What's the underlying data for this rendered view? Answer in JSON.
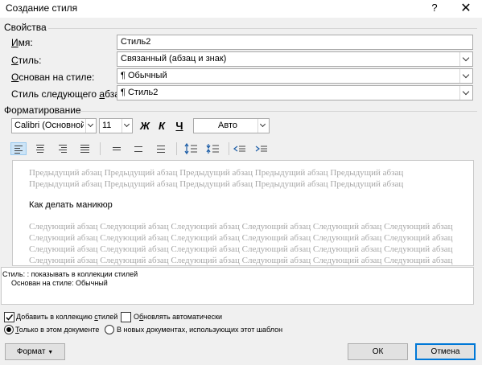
{
  "window": {
    "title": "Создание стиля",
    "help": "?",
    "close": "✕"
  },
  "properties": {
    "section": "Свойства",
    "name_label": "Имя:",
    "name_value": "Стиль2",
    "type_label": "Стиль:",
    "type_value": "Связанный (абзац и знак)",
    "based_label": "Основан на стиле:",
    "based_value": "Обычный",
    "next_label": "Стиль следующего абзаца:",
    "next_value": "Стиль2",
    "para_mark": "¶"
  },
  "formatting": {
    "section": "Форматирование",
    "font": "Calibri (Основной текст)",
    "size": "11",
    "bold": "Ж",
    "italic": "К",
    "underline": "Ч",
    "color": "Авто"
  },
  "preview": {
    "prev_text": "Предыдущий абзац Предыдущий абзац Предыдущий абзац Предыдущий абзац Предыдущий абзац Предыдущий абзац Предыдущий абзац Предыдущий абзац Предыдущий абзац Предыдущий абзац",
    "sample": "Как делать маникюр",
    "next_text": "Следующий абзац Следующий абзац Следующий абзац Следующий абзац Следующий абзац Следующий абзац Следующий абзац Следующий абзац Следующий абзац Следующий абзац Следующий абзац Следующий абзац Следующий абзац Следующий абзац Следующий абзац Следующий абзац Следующий абзац Следующий абзац Следующий абзац Следующий абзац Следующий абзац Следующий абзац Следующий абзац Следующий абзац Следующий абзац"
  },
  "description": {
    "line1": "Стиль: : показывать в коллекции стилей",
    "line2": "Основан на стиле: Обычный"
  },
  "options": {
    "add_gallery": "Добавить в коллекцию стилей",
    "add_gallery_checked": true,
    "auto_update": "Обновлять автоматически",
    "auto_update_checked": false,
    "only_doc": "Только в этом документе",
    "only_doc_selected": true,
    "new_docs": "В новых документах, использующих этот шаблон",
    "new_docs_selected": false
  },
  "buttons": {
    "format": "Формат",
    "ok": "ОК",
    "cancel": "Отмена"
  },
  "colors": {
    "accent": "#0078d7",
    "active_bg": "#cce4f7",
    "ghost_text": "#a6a6a6"
  }
}
